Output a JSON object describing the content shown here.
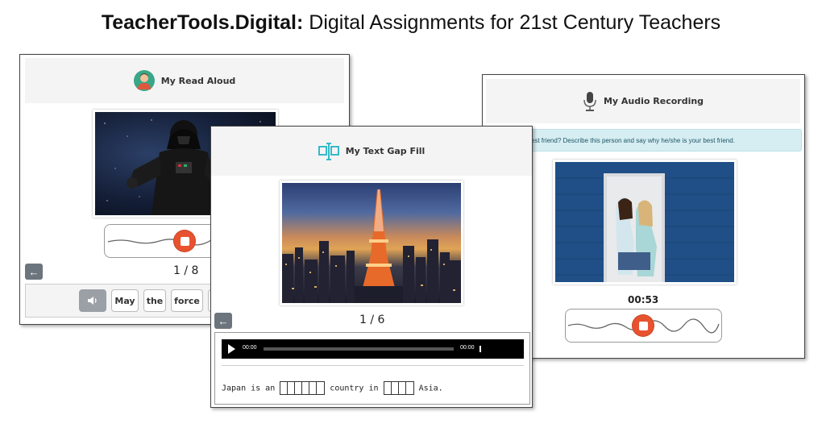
{
  "banner": {
    "brand": "TeacherTools.Digital:",
    "tagline": "Digital Assignments for 21st Century Teachers"
  },
  "read_aloud": {
    "title": "My Read Aloud",
    "counter": "1 / 8",
    "words": [
      "May",
      "the",
      "force"
    ]
  },
  "text_gap": {
    "title": "My Text Gap Fill",
    "counter": "1 / 6",
    "player": {
      "current_time": "00:00",
      "duration": "00:00"
    },
    "sentence": {
      "part1": "Japan is an",
      "gap1_cells": 6,
      "part2": "country in",
      "gap2_cells": 4,
      "part3": "Asia."
    }
  },
  "audio_recording": {
    "title": "My Audio Recording",
    "prompt": "Who is your best friend? Describe this person and say why he/she is your best friend.",
    "timer": "00:53"
  },
  "colors": {
    "record_orange": "#e8532f",
    "prompt_bg": "#d6edf2",
    "back_button": "#6c757d",
    "text_gap_icon": "#22b3c4"
  }
}
